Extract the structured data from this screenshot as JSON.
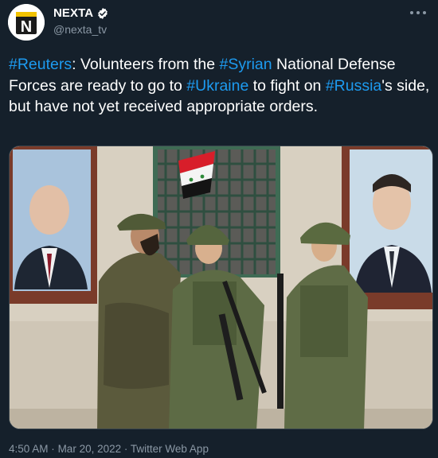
{
  "author": {
    "display_name": "NEXTA",
    "handle": "@nexta_tv",
    "avatar_letter": "N"
  },
  "more_icon": "more-horizontal-icon",
  "text_segments": [
    {
      "text": "#Reuters",
      "hashtag": true
    },
    {
      "text": ": Volunteers from the ",
      "hashtag": false
    },
    {
      "text": "#Syrian",
      "hashtag": true
    },
    {
      "text": " National Defense Forces are ready to go to ",
      "hashtag": false
    },
    {
      "text": "#Ukraine",
      "hashtag": true
    },
    {
      "text": " to fight on ",
      "hashtag": false
    },
    {
      "text": "#Russia",
      "hashtag": true
    },
    {
      "text": "'s side, but have not yet received appropriate orders.",
      "hashtag": false
    }
  ],
  "meta": {
    "time": "4:50 AM",
    "date": "Mar 20, 2022",
    "source": "Twitter Web App",
    "separator": "·"
  },
  "colors": {
    "background": "#15202b",
    "link": "#1d9bf0",
    "secondary_text": "#8b98a5",
    "verified": "#ffffff"
  }
}
